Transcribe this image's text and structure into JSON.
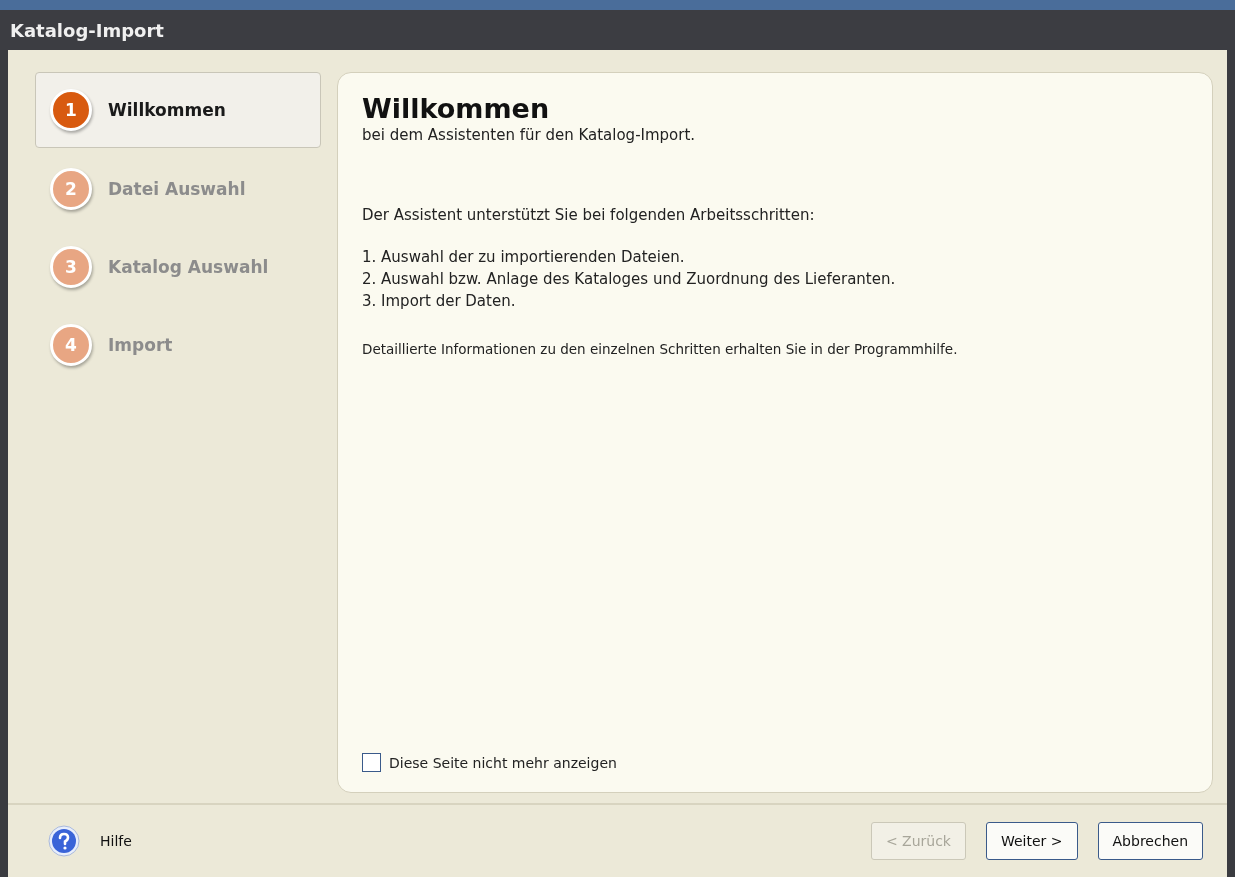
{
  "window": {
    "title": "Katalog-Import"
  },
  "steps": [
    {
      "number": "1",
      "label": "Willkommen",
      "selected": true
    },
    {
      "number": "2",
      "label": "Datei Auswahl",
      "selected": false
    },
    {
      "number": "3",
      "label": "Katalog Auswahl",
      "selected": false
    },
    {
      "number": "4",
      "label": "Import",
      "selected": false
    }
  ],
  "content": {
    "heading": "Willkommen",
    "subtitle": "bei dem Assistenten für den Katalog-Import.",
    "intro": "Der Assistent unterstützt Sie bei folgenden Arbeitsschritten:",
    "list": [
      "1. Auswahl der zu importierenden Dateien.",
      "2. Auswahl bzw. Anlage des Kataloges und Zuordnung des Lieferanten.",
      "3. Import der Daten."
    ],
    "info": "Detaillierte Informationen zu den einzelnen Schritten erhalten Sie in der Programmhilfe.",
    "checkbox": {
      "label": "Diese Seite nicht mehr anzeigen",
      "checked": false
    }
  },
  "footer": {
    "help": "Hilfe",
    "buttons": [
      {
        "label": "< Zurück",
        "disabled": true
      },
      {
        "label": "Weiter >",
        "disabled": false
      },
      {
        "label": "Abbrechen",
        "disabled": false
      }
    ]
  }
}
